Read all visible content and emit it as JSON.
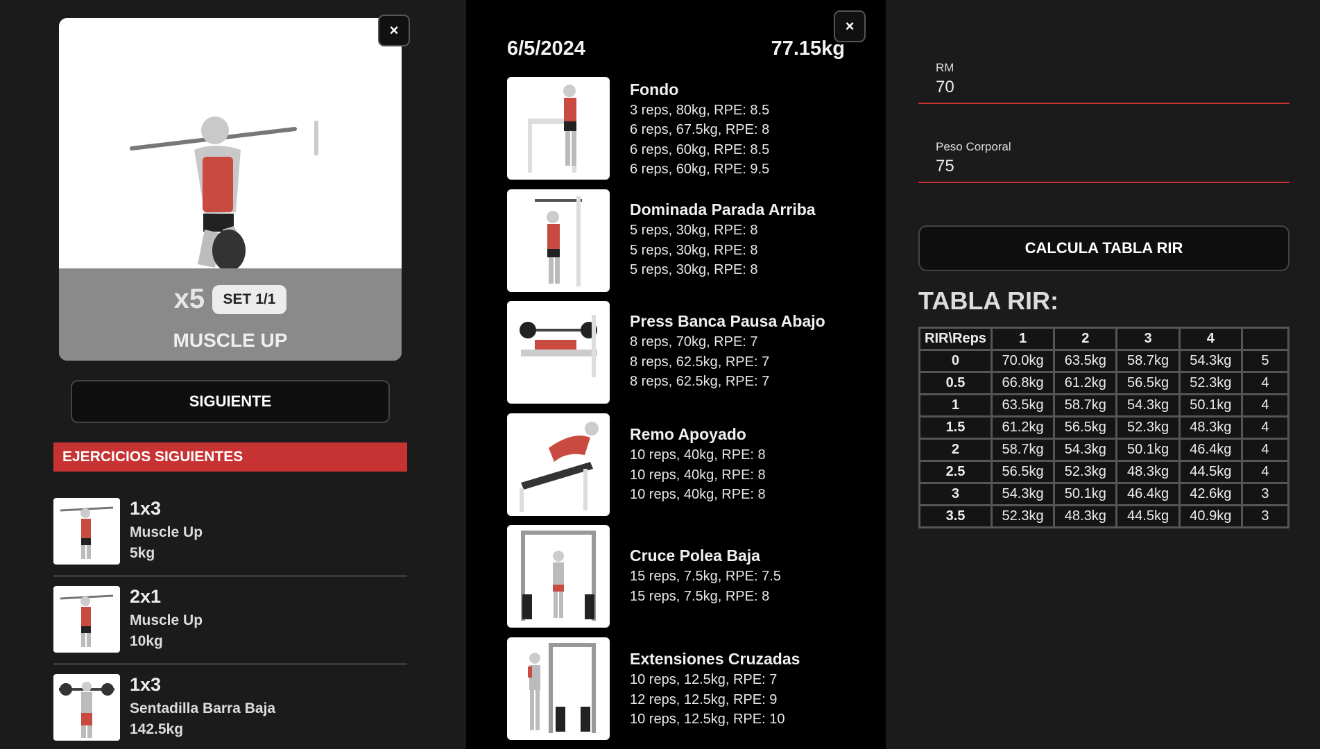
{
  "current": {
    "reps": "x5",
    "set": "SET 1/1",
    "name": "MUSCLE UP",
    "next_button": "SIGUIENTE",
    "close_icon": "close-icon",
    "close_symbol": "×"
  },
  "next_section": {
    "header": "EJERCICIOS SIGUIENTES",
    "items": [
      {
        "sets_reps": "1x3",
        "name": "Muscle Up",
        "weight": "5kg"
      },
      {
        "sets_reps": "2x1",
        "name": "Muscle Up",
        "weight": "10kg"
      },
      {
        "sets_reps": "1x3",
        "name": "Sentadilla Barra Baja",
        "weight": "142.5kg"
      }
    ]
  },
  "history": {
    "date": "6/5/2024",
    "bodyweight": "77.15kg",
    "close_symbol": "×",
    "exercises": [
      {
        "name": "Fondo",
        "sets": [
          "3 reps, 80kg, RPE: 8.5",
          "6 reps, 67.5kg, RPE: 8",
          "6 reps, 60kg, RPE: 8.5",
          "6 reps, 60kg, RPE: 9.5"
        ]
      },
      {
        "name": "Dominada Parada Arriba",
        "sets": [
          "5 reps, 30kg, RPE: 8",
          "5 reps, 30kg, RPE: 8",
          "5 reps, 30kg, RPE: 8"
        ]
      },
      {
        "name": "Press Banca Pausa Abajo",
        "sets": [
          "8 reps, 70kg, RPE: 7",
          "8 reps, 62.5kg, RPE: 7",
          "8 reps, 62.5kg, RPE: 7"
        ]
      },
      {
        "name": "Remo Apoyado",
        "sets": [
          "10 reps, 40kg, RPE: 8",
          "10 reps, 40kg, RPE: 8",
          "10 reps, 40kg, RPE: 8"
        ]
      },
      {
        "name": "Cruce Polea Baja",
        "sets": [
          "15 reps, 7.5kg, RPE: 7.5",
          "15 reps, 7.5kg, RPE: 8"
        ]
      },
      {
        "name": "Extensiones Cruzadas",
        "sets": [
          "10 reps, 12.5kg, RPE: 7",
          "12 reps, 12.5kg, RPE: 9",
          "10 reps, 12.5kg, RPE: 10"
        ]
      }
    ]
  },
  "rir": {
    "rm_label": "RM",
    "rm_value": "70",
    "bw_label": "Peso Corporal",
    "bw_value": "75",
    "calc_button": "CALCULA TABLA RIR",
    "title": "TABLA RIR:",
    "table": {
      "headers": [
        "RIR\\Reps",
        "1",
        "2",
        "3",
        "4",
        ""
      ],
      "rows": [
        {
          "rir": "0",
          "cells": [
            "70.0kg",
            "63.5kg",
            "58.7kg",
            "54.3kg",
            "5"
          ]
        },
        {
          "rir": "0.5",
          "cells": [
            "66.8kg",
            "61.2kg",
            "56.5kg",
            "52.3kg",
            "4"
          ]
        },
        {
          "rir": "1",
          "cells": [
            "63.5kg",
            "58.7kg",
            "54.3kg",
            "50.1kg",
            "4"
          ]
        },
        {
          "rir": "1.5",
          "cells": [
            "61.2kg",
            "56.5kg",
            "52.3kg",
            "48.3kg",
            "4"
          ]
        },
        {
          "rir": "2",
          "cells": [
            "58.7kg",
            "54.3kg",
            "50.1kg",
            "46.4kg",
            "4"
          ]
        },
        {
          "rir": "2.5",
          "cells": [
            "56.5kg",
            "52.3kg",
            "48.3kg",
            "44.5kg",
            "4"
          ]
        },
        {
          "rir": "3",
          "cells": [
            "54.3kg",
            "50.1kg",
            "46.4kg",
            "42.6kg",
            "3"
          ]
        },
        {
          "rir": "3.5",
          "cells": [
            "52.3kg",
            "48.3kg",
            "44.5kg",
            "40.9kg",
            "3"
          ]
        }
      ]
    }
  },
  "colors": {
    "accent": "#c73232",
    "background": "#1b1b1b",
    "middle_bg": "#000000"
  }
}
